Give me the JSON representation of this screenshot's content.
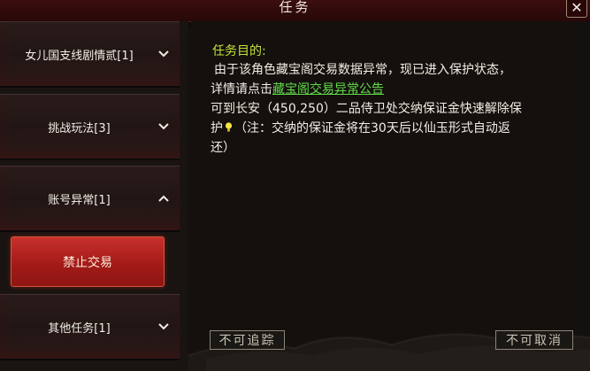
{
  "window": {
    "title": "任务",
    "close_label": "✕"
  },
  "categories": [
    {
      "label": "女儿国支线剧情贰[1]",
      "expanded": false
    },
    {
      "label": "挑战玩法[3]",
      "expanded": false
    },
    {
      "label": "账号异常[1]",
      "expanded": true
    },
    {
      "label": "其他任务[1]",
      "expanded": false
    }
  ],
  "selected_task": {
    "label": "禁止交易"
  },
  "detail": {
    "heading": "任务目的:",
    "line1": "由于该角色藏宝阁交易数据异常，现已进入保护状态，",
    "line2_prefix": "详情请点击",
    "line2_link": "藏宝阁交易异常公告",
    "line3": "可到长安（450,250）二品侍卫处交纳保证金快速解除保",
    "line4_prefix": "护",
    "line4_suffix": "（注：交纳的保证金将在30天后以仙玉形式自动返",
    "line5": "还）"
  },
  "buttons": {
    "track": "不可追踪",
    "cancel": "不可取消"
  },
  "colors": {
    "header": "#2f0b0b",
    "selected": "#b3221f",
    "heading": "#c7e23a",
    "link": "#62dd4a"
  }
}
